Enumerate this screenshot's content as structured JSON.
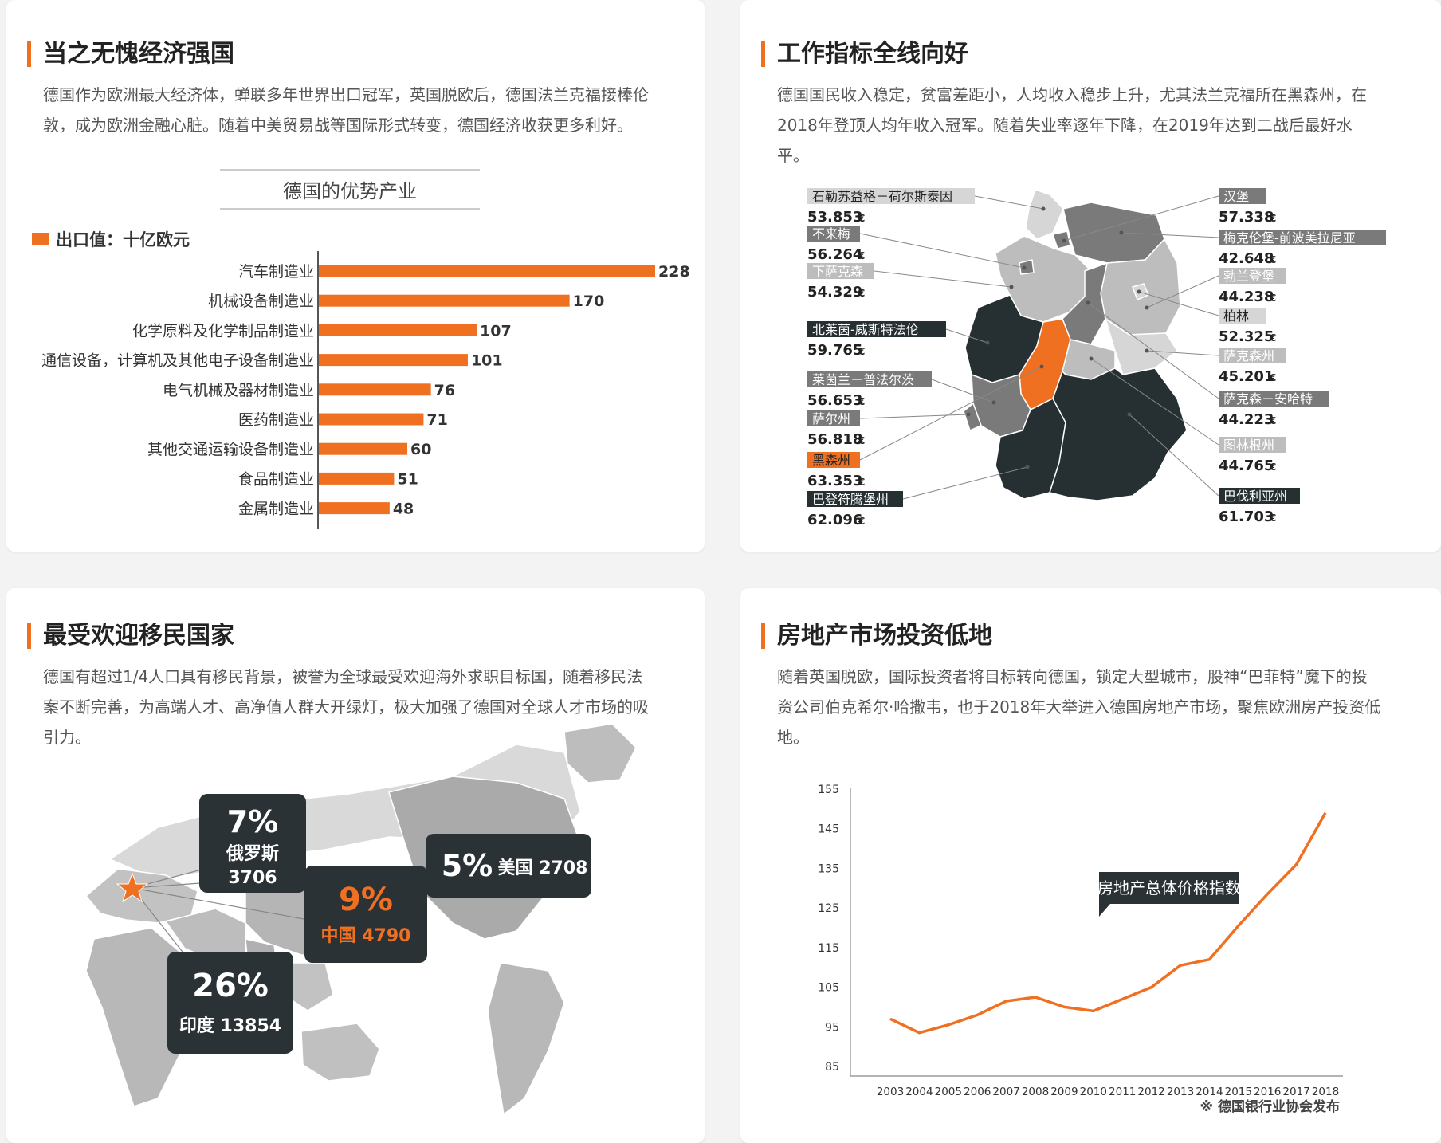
{
  "colors": {
    "accent": "#f07022",
    "dark": "#2b3236",
    "region_dark": "#263033",
    "region_mid": "#7a7a7a",
    "region_light": "#bdbdbd",
    "region_pale": "#d6d6d6"
  },
  "cards": [
    {
      "title": "当之无愧经济强国",
      "desc": "德国作为欧洲最大经济体，蝉联多年世界出口冠军，英国脱欧后，德国法兰克福接棒伦敦，成为欧洲金融心脏。随着中美贸易战等国际形式转变，德国经济收获更多利好。"
    },
    {
      "title": "工作指标全线向好",
      "desc": "德国国民收入稳定，贫富差距小，人均收入稳步上升，尤其法兰克福所在黑森州，在2018年登顶人均年收入冠军。随着失业率逐年下降，在2019年达到二战后最好水平。"
    },
    {
      "title": "最受欢迎移民国家",
      "desc": "德国有超过1/4人口具有移民背景，被誉为全球最受欢迎海外求职目标国，随着移民法案不断完善，为高端人才、高净值人群大开绿灯，极大加强了德国对全球人才市场的吸引力。"
    },
    {
      "title": "房地产市场投资低地",
      "desc": "随着英国脱欧，国际投资者将目标转向德国，锁定大型城市，股神“巴菲特”魔下的投资公司伯克希尔·哈撒韦，也于2018年大举进入德国房地产市场，聚焦欧洲房产投资低地。"
    }
  ],
  "chart_data": [
    {
      "type": "bar",
      "title": "德国的优势产业",
      "legend": "出口值：十亿欧元",
      "categories": [
        "汽车制造业",
        "机械设备制造业",
        "化学原料及化学制品制造业",
        "通信设备，计算机及其他电子设备制造业",
        "电气机械及器材制造业",
        "医药制造业",
        "其他交通运输设备制造业",
        "食品制造业",
        "金属制造业"
      ],
      "values": [
        228,
        170,
        107,
        101,
        76,
        71,
        60,
        51,
        48
      ],
      "orientation": "horizontal"
    },
    {
      "type": "line",
      "series": [
        {
          "name": "房地产总体价格指数",
          "values": [
            97,
            93.5,
            95.5,
            98,
            101.5,
            102.5,
            100,
            99,
            102,
            105,
            110.5,
            112,
            120.5,
            128.5,
            136,
            149
          ]
        }
      ],
      "x": [
        "2003",
        "2004",
        "2005",
        "2006",
        "2007",
        "2008",
        "2009",
        "2010",
        "2011",
        "2012",
        "2013",
        "2014",
        "2015",
        "2016",
        "2017",
        "2018"
      ],
      "yticks": [
        "155",
        "145",
        "135",
        "125",
        "115",
        "105",
        "95",
        "85"
      ],
      "ylim": [
        85,
        155
      ],
      "source": "※ 德国银行业协会发布"
    }
  ],
  "income_map": {
    "left": [
      {
        "name": "石勒苏益格－荷尔斯泰因",
        "value": "53.853",
        "style": "pale"
      },
      {
        "name": "不来梅",
        "value": "56.264",
        "style": "mid"
      },
      {
        "name": "下萨克森",
        "value": "54.329",
        "style": "light"
      },
      {
        "name": "北莱茵-威斯特法伦",
        "value": "59.765",
        "style": "dark"
      },
      {
        "name": "莱茵兰－普法尔茨",
        "value": "56.653",
        "style": "mid"
      },
      {
        "name": "萨尔州",
        "value": "56.818",
        "style": "mid"
      },
      {
        "name": "黑森州",
        "value": "63.353",
        "style": "accent"
      },
      {
        "name": "巴登符腾堡州",
        "value": "62.096",
        "style": "dark"
      }
    ],
    "right": [
      {
        "name": "汉堡",
        "value": "57.338",
        "style": "mid"
      },
      {
        "name": "梅克伦堡-前波美拉尼亚",
        "value": "42.648",
        "style": "mid"
      },
      {
        "name": "勃兰登堡",
        "value": "44.238",
        "style": "light"
      },
      {
        "name": "柏林",
        "value": "52.325",
        "style": "pale"
      },
      {
        "name": "萨克森州",
        "value": "45.201",
        "style": "light"
      },
      {
        "name": "萨克森－安哈特",
        "value": "44.223",
        "style": "mid"
      },
      {
        "name": "图林根州",
        "value": "44.765",
        "style": "light"
      },
      {
        "name": "巴伐利亚州",
        "value": "61.703",
        "style": "dark"
      }
    ],
    "currency": "€"
  },
  "migration": [
    {
      "pct": "7%",
      "label1": "俄罗斯",
      "label2": "3706"
    },
    {
      "pct": "5%",
      "label1": "美国 2708"
    },
    {
      "pct": "9%",
      "label1": "中国 4790",
      "accent": true
    },
    {
      "pct": "26%",
      "label1": "印度 13854"
    }
  ]
}
